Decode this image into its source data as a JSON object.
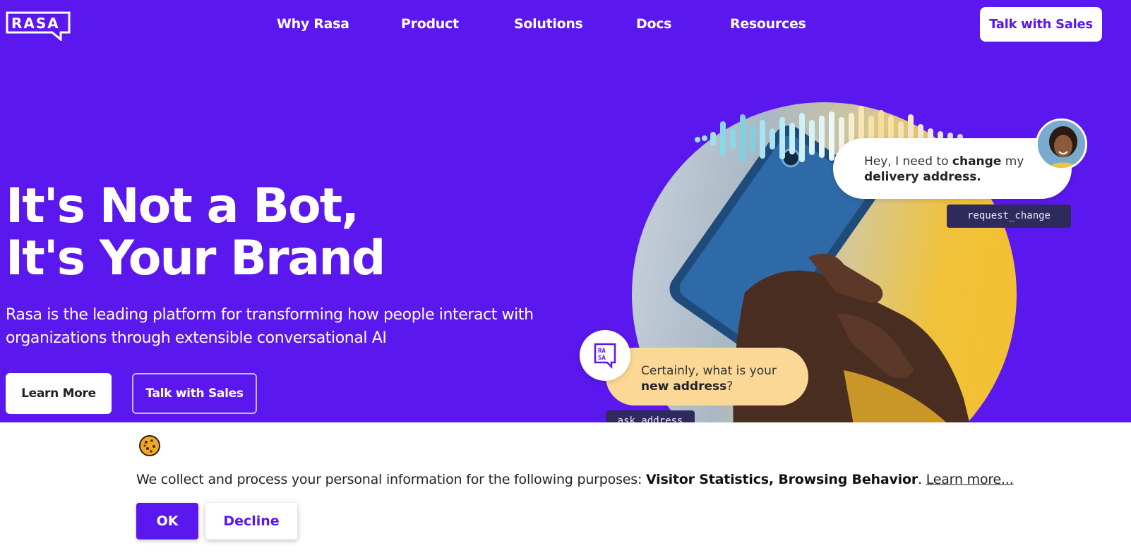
{
  "nav": {
    "logo_text": "RASA",
    "links": [
      {
        "label": "Why Rasa"
      },
      {
        "label": "Product"
      },
      {
        "label": "Solutions"
      },
      {
        "label": "Docs"
      },
      {
        "label": "Resources"
      }
    ],
    "cta_label": "Talk with Sales"
  },
  "hero": {
    "title_line1": "It's Not a Bot,",
    "title_line2": "It's Your Brand",
    "subtitle": "Rasa is the leading platform for transforming how people interact with organizations through extensible conversational AI",
    "primary_button": "Learn More",
    "secondary_button": "Talk with Sales"
  },
  "conversation": {
    "user_message_part1": "Hey, I need to ",
    "user_message_bold1": "change",
    "user_message_part2": " my ",
    "user_message_bold2": "delivery address.",
    "user_intent_tag": "request_change",
    "bot_message_part1": "Certainly, what is your ",
    "bot_message_bold": "new address",
    "bot_message_part2": "?",
    "bot_action_tag": "ask_address",
    "bot_icon_text": "RASA"
  },
  "cookie_banner": {
    "text_prefix": "We collect and process your personal information for the following purposes: ",
    "purposes": "Visitor Statistics, Browsing Behavior",
    "text_suffix": ". ",
    "learn_more_link": "Learn more...",
    "ok_button": "OK",
    "decline_button": "Decline"
  },
  "colors": {
    "brand_purple": "#5a17ee",
    "bot_bubble": "#fcd896",
    "tag_bg": "#2e2a5c"
  }
}
